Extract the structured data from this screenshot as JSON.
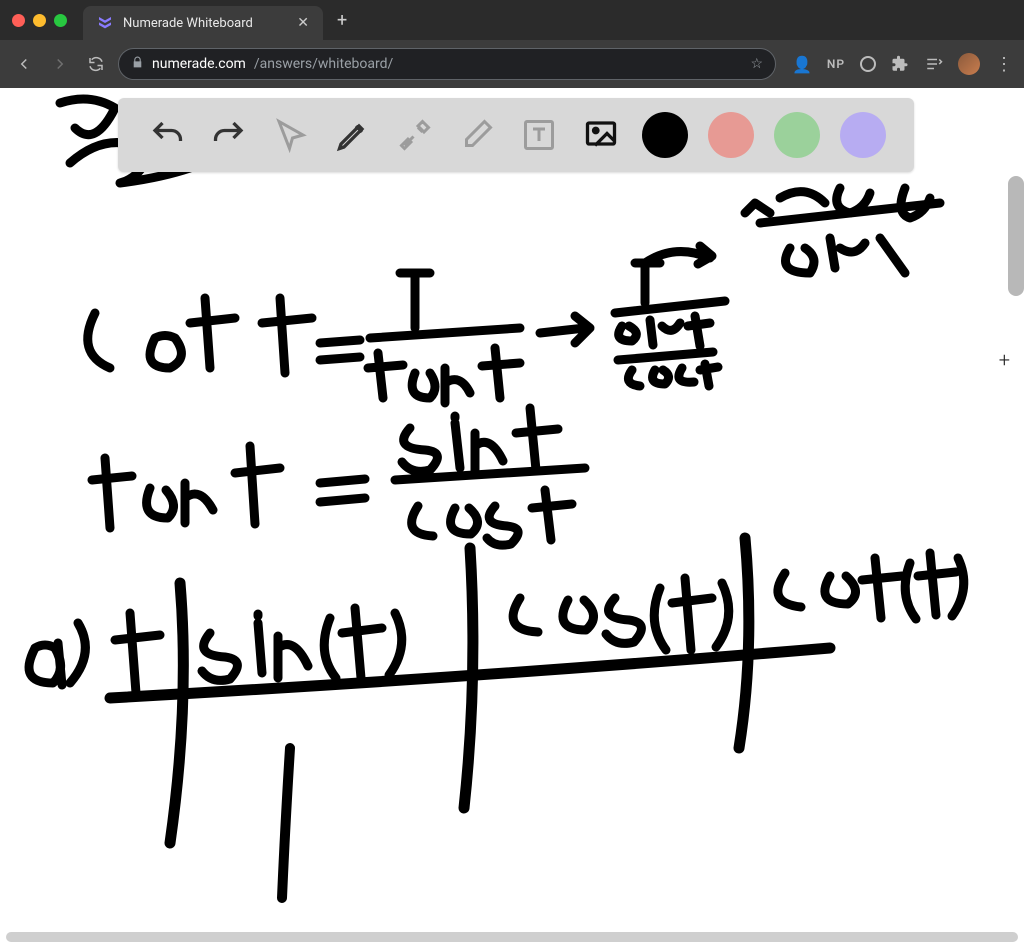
{
  "window": {
    "tab_title": "Numerade Whiteboard"
  },
  "browser": {
    "url_domain": "numerade.com",
    "url_path": "/answers/whiteboard/",
    "ext_np_label": "NP"
  },
  "toolbar": {
    "icons": {
      "undo": "undo-icon",
      "redo": "redo-icon",
      "pointer": "pointer-icon",
      "pencil": "pencil-icon",
      "tools": "tools-icon",
      "eraser": "eraser-icon",
      "text": "text-icon",
      "image": "image-icon"
    },
    "colors": {
      "black": "#000000",
      "red": "#e79a94",
      "green": "#9bd19b",
      "purple": "#b7acf2"
    }
  },
  "handwriting": {
    "line1": "cot t = 1 / tan t → 1 / (sin t / cos t) = cos t / sin t",
    "line2": "tan t = sin t / cos t",
    "table_label": "a)",
    "table_headers": [
      "t",
      "sin(t)",
      "cos(t)",
      "cot(t)"
    ]
  }
}
